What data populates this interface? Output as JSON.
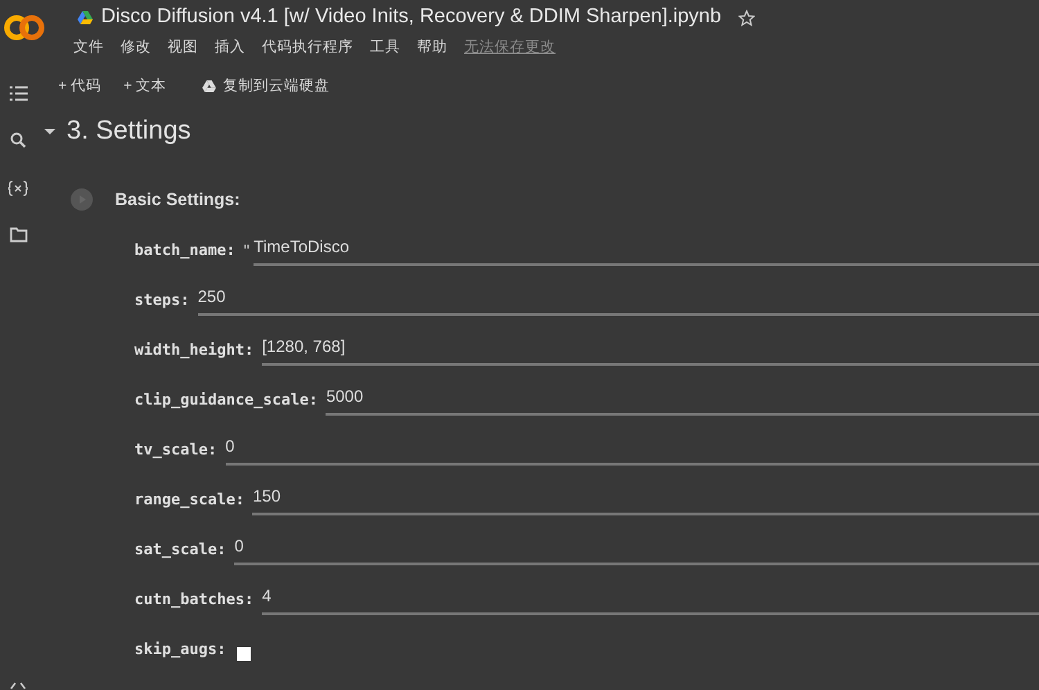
{
  "notebook": {
    "title": "Disco Diffusion v4.1 [w/ Video Inits, Recovery & DDIM Sharpen].ipynb",
    "starred": false
  },
  "menu": [
    {
      "label": "文件",
      "disabled": false
    },
    {
      "label": "修改",
      "disabled": false
    },
    {
      "label": "视图",
      "disabled": false
    },
    {
      "label": "插入",
      "disabled": false
    },
    {
      "label": "代码执行程序",
      "disabled": false
    },
    {
      "label": "工具",
      "disabled": false
    },
    {
      "label": "帮助",
      "disabled": false
    },
    {
      "label": "无法保存更改",
      "disabled": true
    }
  ],
  "toolbar": [
    "+ 代码",
    "+ 文本",
    "复制到云端硬盘"
  ],
  "section": {
    "title": "3. Settings",
    "expanded": true
  },
  "form": {
    "title": "Basic Settings:",
    "fields": [
      {
        "kind": "text",
        "label": "batch_name:",
        "prefix": "\"",
        "value": "TimeToDisco"
      },
      {
        "kind": "text",
        "label": "steps:",
        "value": "250"
      },
      {
        "kind": "text",
        "label": "width_height:",
        "value": "[1280, 768]"
      },
      {
        "kind": "text",
        "label": "clip_guidance_scale:",
        "value": "5000"
      },
      {
        "kind": "text",
        "label": "tv_scale:",
        "value": "0"
      },
      {
        "kind": "text",
        "label": "range_scale:",
        "value": "150"
      },
      {
        "kind": "text",
        "label": "sat_scale:",
        "value": "0"
      },
      {
        "kind": "text",
        "label": "cutn_batches:",
        "value": "4"
      },
      {
        "kind": "checkbox",
        "label": "skip_augs:",
        "checked": false
      }
    ]
  }
}
